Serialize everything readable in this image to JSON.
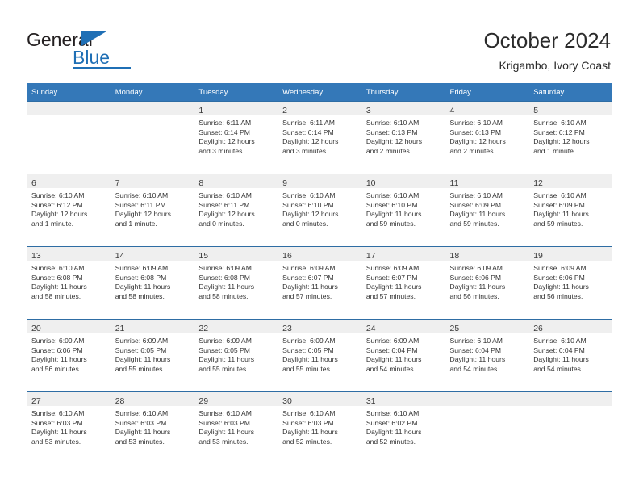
{
  "brand": {
    "name_part1": "General",
    "name_part2": "Blue",
    "accent_color": "#1f6fb5"
  },
  "header": {
    "title": "October 2024",
    "subtitle": "Krigambo, Ivory Coast"
  },
  "calendar": {
    "header_bg": "#3478b8",
    "weekdays": [
      "Sunday",
      "Monday",
      "Tuesday",
      "Wednesday",
      "Thursday",
      "Friday",
      "Saturday"
    ],
    "weeks": [
      [
        {
          "empty": true
        },
        {
          "empty": true
        },
        {
          "day": "1",
          "sunrise": "Sunrise: 6:11 AM",
          "sunset": "Sunset: 6:14 PM",
          "daylight1": "Daylight: 12 hours",
          "daylight2": "and 3 minutes."
        },
        {
          "day": "2",
          "sunrise": "Sunrise: 6:11 AM",
          "sunset": "Sunset: 6:14 PM",
          "daylight1": "Daylight: 12 hours",
          "daylight2": "and 3 minutes."
        },
        {
          "day": "3",
          "sunrise": "Sunrise: 6:10 AM",
          "sunset": "Sunset: 6:13 PM",
          "daylight1": "Daylight: 12 hours",
          "daylight2": "and 2 minutes."
        },
        {
          "day": "4",
          "sunrise": "Sunrise: 6:10 AM",
          "sunset": "Sunset: 6:13 PM",
          "daylight1": "Daylight: 12 hours",
          "daylight2": "and 2 minutes."
        },
        {
          "day": "5",
          "sunrise": "Sunrise: 6:10 AM",
          "sunset": "Sunset: 6:12 PM",
          "daylight1": "Daylight: 12 hours",
          "daylight2": "and 1 minute."
        }
      ],
      [
        {
          "day": "6",
          "sunrise": "Sunrise: 6:10 AM",
          "sunset": "Sunset: 6:12 PM",
          "daylight1": "Daylight: 12 hours",
          "daylight2": "and 1 minute."
        },
        {
          "day": "7",
          "sunrise": "Sunrise: 6:10 AM",
          "sunset": "Sunset: 6:11 PM",
          "daylight1": "Daylight: 12 hours",
          "daylight2": "and 1 minute."
        },
        {
          "day": "8",
          "sunrise": "Sunrise: 6:10 AM",
          "sunset": "Sunset: 6:11 PM",
          "daylight1": "Daylight: 12 hours",
          "daylight2": "and 0 minutes."
        },
        {
          "day": "9",
          "sunrise": "Sunrise: 6:10 AM",
          "sunset": "Sunset: 6:10 PM",
          "daylight1": "Daylight: 12 hours",
          "daylight2": "and 0 minutes."
        },
        {
          "day": "10",
          "sunrise": "Sunrise: 6:10 AM",
          "sunset": "Sunset: 6:10 PM",
          "daylight1": "Daylight: 11 hours",
          "daylight2": "and 59 minutes."
        },
        {
          "day": "11",
          "sunrise": "Sunrise: 6:10 AM",
          "sunset": "Sunset: 6:09 PM",
          "daylight1": "Daylight: 11 hours",
          "daylight2": "and 59 minutes."
        },
        {
          "day": "12",
          "sunrise": "Sunrise: 6:10 AM",
          "sunset": "Sunset: 6:09 PM",
          "daylight1": "Daylight: 11 hours",
          "daylight2": "and 59 minutes."
        }
      ],
      [
        {
          "day": "13",
          "sunrise": "Sunrise: 6:10 AM",
          "sunset": "Sunset: 6:08 PM",
          "daylight1": "Daylight: 11 hours",
          "daylight2": "and 58 minutes."
        },
        {
          "day": "14",
          "sunrise": "Sunrise: 6:09 AM",
          "sunset": "Sunset: 6:08 PM",
          "daylight1": "Daylight: 11 hours",
          "daylight2": "and 58 minutes."
        },
        {
          "day": "15",
          "sunrise": "Sunrise: 6:09 AM",
          "sunset": "Sunset: 6:08 PM",
          "daylight1": "Daylight: 11 hours",
          "daylight2": "and 58 minutes."
        },
        {
          "day": "16",
          "sunrise": "Sunrise: 6:09 AM",
          "sunset": "Sunset: 6:07 PM",
          "daylight1": "Daylight: 11 hours",
          "daylight2": "and 57 minutes."
        },
        {
          "day": "17",
          "sunrise": "Sunrise: 6:09 AM",
          "sunset": "Sunset: 6:07 PM",
          "daylight1": "Daylight: 11 hours",
          "daylight2": "and 57 minutes."
        },
        {
          "day": "18",
          "sunrise": "Sunrise: 6:09 AM",
          "sunset": "Sunset: 6:06 PM",
          "daylight1": "Daylight: 11 hours",
          "daylight2": "and 56 minutes."
        },
        {
          "day": "19",
          "sunrise": "Sunrise: 6:09 AM",
          "sunset": "Sunset: 6:06 PM",
          "daylight1": "Daylight: 11 hours",
          "daylight2": "and 56 minutes."
        }
      ],
      [
        {
          "day": "20",
          "sunrise": "Sunrise: 6:09 AM",
          "sunset": "Sunset: 6:06 PM",
          "daylight1": "Daylight: 11 hours",
          "daylight2": "and 56 minutes."
        },
        {
          "day": "21",
          "sunrise": "Sunrise: 6:09 AM",
          "sunset": "Sunset: 6:05 PM",
          "daylight1": "Daylight: 11 hours",
          "daylight2": "and 55 minutes."
        },
        {
          "day": "22",
          "sunrise": "Sunrise: 6:09 AM",
          "sunset": "Sunset: 6:05 PM",
          "daylight1": "Daylight: 11 hours",
          "daylight2": "and 55 minutes."
        },
        {
          "day": "23",
          "sunrise": "Sunrise: 6:09 AM",
          "sunset": "Sunset: 6:05 PM",
          "daylight1": "Daylight: 11 hours",
          "daylight2": "and 55 minutes."
        },
        {
          "day": "24",
          "sunrise": "Sunrise: 6:09 AM",
          "sunset": "Sunset: 6:04 PM",
          "daylight1": "Daylight: 11 hours",
          "daylight2": "and 54 minutes."
        },
        {
          "day": "25",
          "sunrise": "Sunrise: 6:10 AM",
          "sunset": "Sunset: 6:04 PM",
          "daylight1": "Daylight: 11 hours",
          "daylight2": "and 54 minutes."
        },
        {
          "day": "26",
          "sunrise": "Sunrise: 6:10 AM",
          "sunset": "Sunset: 6:04 PM",
          "daylight1": "Daylight: 11 hours",
          "daylight2": "and 54 minutes."
        }
      ],
      [
        {
          "day": "27",
          "sunrise": "Sunrise: 6:10 AM",
          "sunset": "Sunset: 6:03 PM",
          "daylight1": "Daylight: 11 hours",
          "daylight2": "and 53 minutes."
        },
        {
          "day": "28",
          "sunrise": "Sunrise: 6:10 AM",
          "sunset": "Sunset: 6:03 PM",
          "daylight1": "Daylight: 11 hours",
          "daylight2": "and 53 minutes."
        },
        {
          "day": "29",
          "sunrise": "Sunrise: 6:10 AM",
          "sunset": "Sunset: 6:03 PM",
          "daylight1": "Daylight: 11 hours",
          "daylight2": "and 53 minutes."
        },
        {
          "day": "30",
          "sunrise": "Sunrise: 6:10 AM",
          "sunset": "Sunset: 6:03 PM",
          "daylight1": "Daylight: 11 hours",
          "daylight2": "and 52 minutes."
        },
        {
          "day": "31",
          "sunrise": "Sunrise: 6:10 AM",
          "sunset": "Sunset: 6:02 PM",
          "daylight1": "Daylight: 11 hours",
          "daylight2": "and 52 minutes."
        },
        {
          "empty": true
        },
        {
          "empty": true
        }
      ]
    ]
  }
}
